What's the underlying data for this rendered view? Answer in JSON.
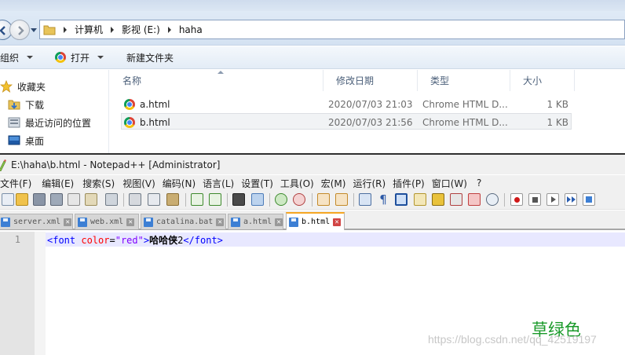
{
  "explorer": {
    "breadcrumbs": [
      "计算机",
      "影视 (E:)",
      "haha"
    ],
    "toolbar": {
      "organize": "组织",
      "open": "打开",
      "new_folder": "新建文件夹"
    },
    "nav": {
      "favorites": "收藏夹",
      "downloads": "下载",
      "recent": "最近访问的位置",
      "desktop": "桌面"
    },
    "columns": {
      "name": "名称",
      "date": "修改日期",
      "type": "类型",
      "size": "大小"
    },
    "files": [
      {
        "name": "a.html",
        "date": "2020/07/03 21:03",
        "type": "Chrome HTML D...",
        "size": "1 KB"
      },
      {
        "name": "b.html",
        "date": "2020/07/03 21:56",
        "type": "Chrome HTML D...",
        "size": "1 KB"
      }
    ]
  },
  "notepad": {
    "title": "E:\\haha\\b.html - Notepad++ [Administrator]",
    "menu": [
      "文件(F)",
      "编辑(E)",
      "搜索(S)",
      "视图(V)",
      "编码(N)",
      "语言(L)",
      "设置(T)",
      "工具(O)",
      "宏(M)",
      "运行(R)",
      "插件(P)",
      "窗口(W)",
      "?"
    ],
    "tabs": [
      {
        "label": "server.xml"
      },
      {
        "label": "web.xml"
      },
      {
        "label": "catalina.bat"
      },
      {
        "label": "a.html"
      },
      {
        "label": "b.html"
      }
    ],
    "line_number": "1",
    "code": {
      "open_tag": "<font",
      "attr": "color",
      "eq": "=",
      "value": "\"red\"",
      "close_bracket": ">",
      "text": "哈哈侠",
      "text2": "2",
      "end_tag": "</font>"
    }
  },
  "annotation": "草绿色",
  "watermark": "https://blog.csdn.net/qq_42519197",
  "colors": {
    "annotation": "#1a9a2a",
    "tag": "#0000ff",
    "attribute": "#ff0000",
    "string": "#8000ff",
    "active_tab_accent": "#f5a623"
  }
}
